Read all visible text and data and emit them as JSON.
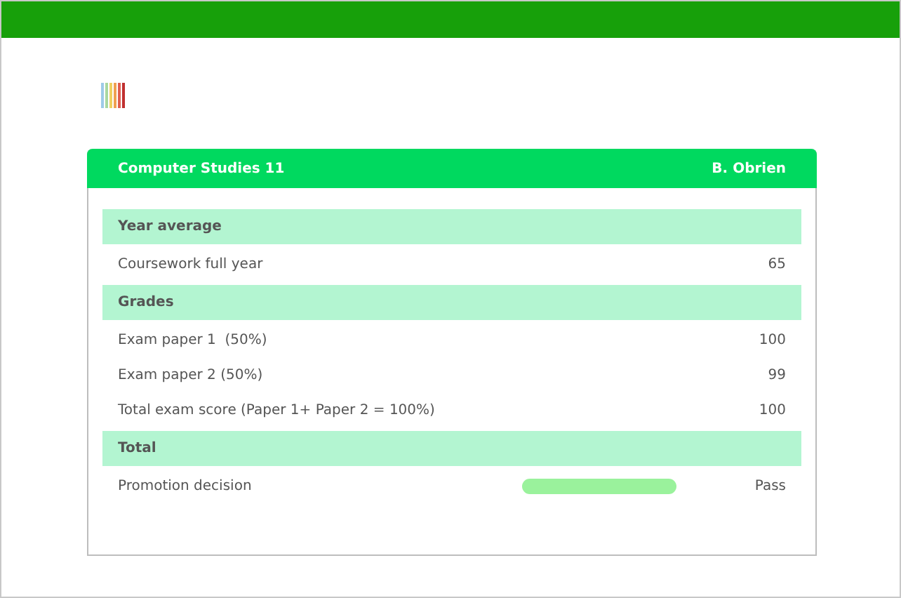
{
  "card": {
    "title": "Computer Studies 11",
    "teacher": "B. Obrien"
  },
  "rows": [
    {
      "kind": "section",
      "label": "Year average"
    },
    {
      "kind": "row",
      "label": "Coursework full year",
      "value": "65"
    },
    {
      "kind": "section",
      "label": "Grades"
    },
    {
      "kind": "row",
      "label": "Exam paper 1  (50%)",
      "value": "100"
    },
    {
      "kind": "row",
      "label": "Exam paper 2 (50%)",
      "value": "99"
    },
    {
      "kind": "row",
      "label": "Total exam score (Paper 1+ Paper 2 = 100%)",
      "value": "100"
    },
    {
      "kind": "section",
      "label": "Total"
    },
    {
      "kind": "decision",
      "label": "Promotion decision",
      "value": "Pass"
    }
  ]
}
